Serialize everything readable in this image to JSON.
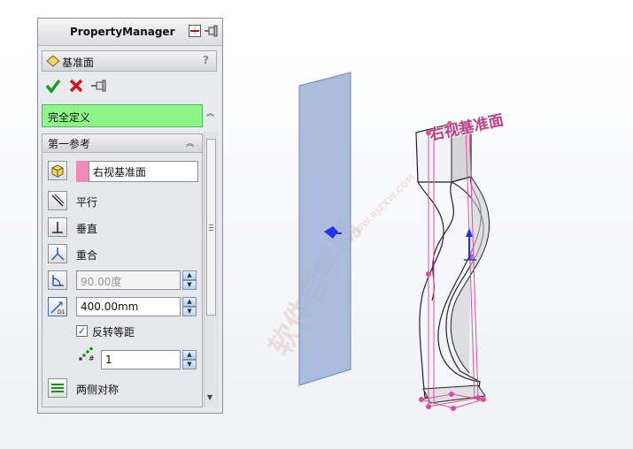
{
  "property_manager": {
    "title": "PropertyManager",
    "feature": {
      "name": "基准面",
      "help": "?"
    },
    "actions": {
      "ok_icon": "check-icon",
      "cancel_icon": "x-icon",
      "pin_icon": "pushpin-icon"
    },
    "status": "完全定义",
    "first_reference": {
      "header": "第一参考",
      "selection": "右视基准面",
      "options": {
        "parallel": "平行",
        "perpendicular": "垂直",
        "coincident": "重合"
      },
      "angle_value": "90.00度",
      "distance_value": "400.00mm",
      "flip_offset": {
        "label": "反转等距",
        "checked": true
      },
      "count_value": "1",
      "mid_plane": "两侧对称"
    }
  },
  "viewport": {
    "plane_label": "右视基准面",
    "watermark": "软件自学网",
    "watermark_url": "WWW.RJZXW.COM"
  },
  "colors": {
    "status_green": "#8ff58b",
    "plane_fill": "#9eb2d6",
    "annotation_pink": "#d9529b",
    "accent_blue": "#1f3fe0"
  }
}
